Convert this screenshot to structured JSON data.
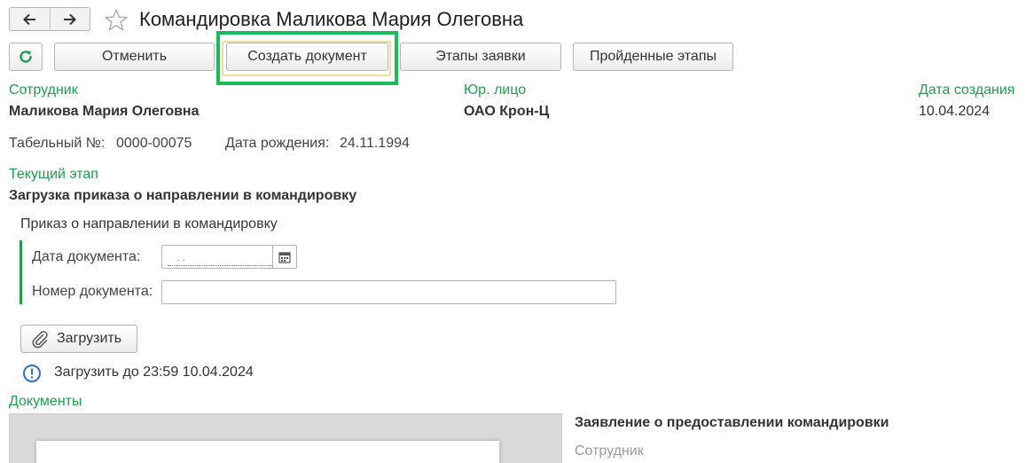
{
  "window": {
    "title": "Командировка Маликова Мария Олеговна"
  },
  "toolbar": {
    "cancel_label": "Отменить",
    "create_document_label": "Создать документ",
    "request_stages_label": "Этапы заявки",
    "passed_stages_label": "Пройденные этапы"
  },
  "header": {
    "employee_label": "Сотрудник",
    "employee_value": "Маликова Мария Олеговна",
    "legal_entity_label": "Юр. лицо",
    "legal_entity_value": "ОАО Крон-Ц",
    "created_label": "Дата создания",
    "created_value": "10.04.2024",
    "tab_number_label": "Табельный №:",
    "tab_number_value": "0000-00075",
    "birth_date_label": "Дата рождения:",
    "birth_date_value": "24.11.1994"
  },
  "stage": {
    "label": "Текущий этап",
    "value": "Загрузка приказа о направлении в командировку",
    "group_title": "Приказ о направлении в командировку",
    "doc_date_label": "Дата документа:",
    "doc_date_placeholder": ".  .",
    "doc_number_label": "Номер документа:",
    "doc_number_value": "",
    "upload_label": "Загрузить",
    "deadline_text": "Загрузить до 23:59 10.04.2024"
  },
  "documents": {
    "label": "Документы",
    "side_title": "Заявление о предоставлении командировки",
    "side_employee_label": "Сотрудник"
  },
  "colors": {
    "accent_green": "#1f9e4e",
    "highlight_green": "#1bba5a",
    "info_blue": "#2a6fd6",
    "required_red": "#e05050"
  }
}
